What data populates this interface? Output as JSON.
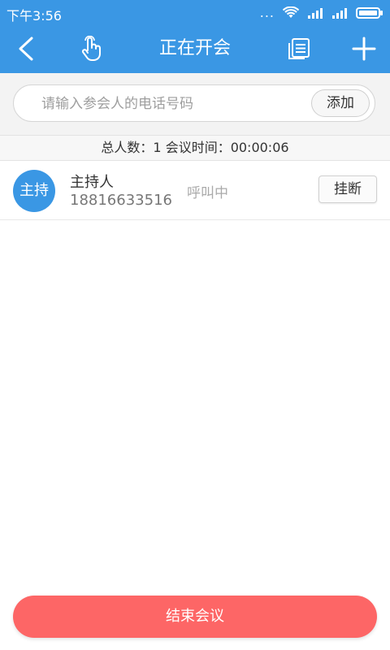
{
  "status_bar": {
    "time": "下午3:56",
    "dots": "..."
  },
  "header": {
    "title": "正在开会",
    "icons": [
      "back-icon",
      "touch-icon",
      "copy-list-icon",
      "plus-icon"
    ],
    "background": "#3a97e4"
  },
  "search": {
    "placeholder": "请输入参会人的电话号码",
    "value": "",
    "add_label": "添加"
  },
  "summary": {
    "text": "总人数：1  会议时间：00:00:06"
  },
  "participants": [
    {
      "avatar_label": "主持",
      "name": "主持人",
      "phone": "18816633516",
      "status": "呼叫中",
      "hangup_label": "挂断"
    }
  ],
  "footer": {
    "end_label": "结束会议",
    "accent": "#fd6666"
  }
}
